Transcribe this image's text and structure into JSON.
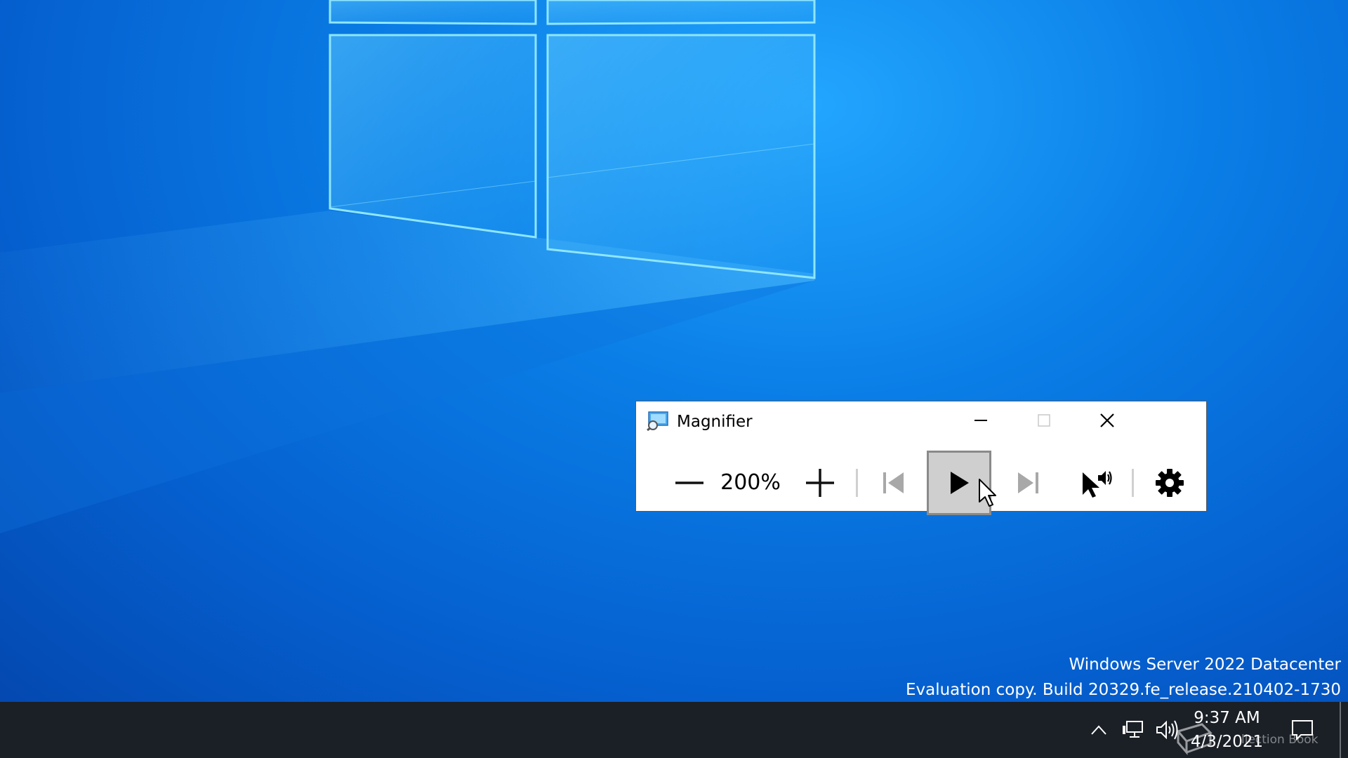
{
  "window": {
    "title": "Magnifier",
    "zoom_level": "200%"
  },
  "toolbar": {
    "zoom_out_icon": "minus-icon",
    "zoom_in_icon": "plus-icon",
    "prev_icon": "skip-previous-icon",
    "play_icon": "play-icon",
    "next_icon": "skip-next-icon",
    "read_from_here_icon": "pointer-speaker-icon",
    "settings_icon": "gear-icon"
  },
  "watermark": {
    "line1": "Windows Server 2022 Datacenter",
    "line2": "Evaluation copy. Build 20329.fe_release.210402-1730"
  },
  "taskbar": {
    "time": "9:37 AM",
    "date": "4/3/2021",
    "overlay_text": "llection Book"
  },
  "colors": {
    "desktop": "#0a7ee6",
    "taskbar": "#1b2027",
    "play_button_bg": "#cfcfcf"
  }
}
